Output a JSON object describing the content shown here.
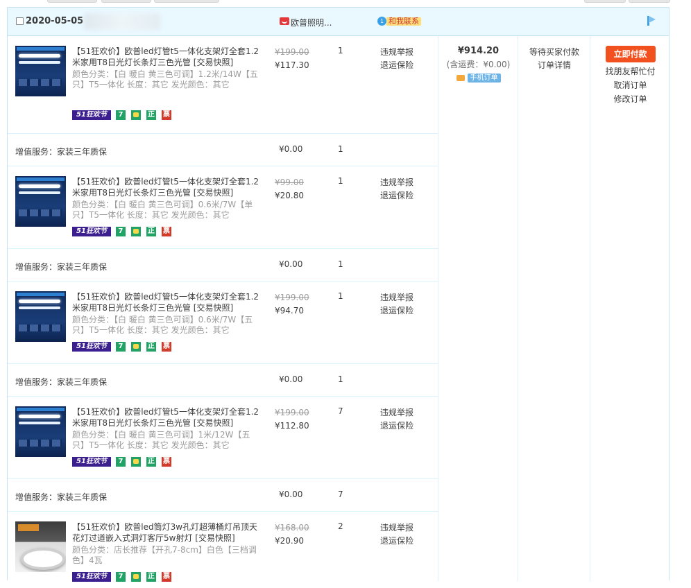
{
  "header": {
    "date": "2020-05-05",
    "shop_name": "欧普照明...",
    "contact_label": "和我联系",
    "chat_badge": "1"
  },
  "items": [
    {
      "title": "【51狂欢价】欧普led灯管t5一体化支架灯全套1.2米家用T8日光灯长条灯三色光管 [交易快照]",
      "spec": "颜色分类：【白 暖白 黄三色可调】1.2米/14W【五只】T5一体化 长度：其它 发光颜色：其它",
      "original_price": "¥199.00",
      "price": "¥117.30",
      "qty": "1",
      "op1": "违规举报",
      "op2": "退运保险"
    },
    {
      "title": "【51狂欢价】欧普led灯管t5一体化支架灯全套1.2米家用T8日光灯长条灯三色光管 [交易快照]",
      "spec": "颜色分类：【白 暖白 黄三色可调】0.6米/7W【单只】T5一体化 长度：其它 发光颜色：其它",
      "original_price": "¥99.00",
      "price": "¥20.80",
      "qty": "1",
      "op1": "违规举报",
      "op2": "退运保险"
    },
    {
      "title": "【51狂欢价】欧普led灯管t5一体化支架灯全套1.2米家用T8日光灯长条灯三色光管 [交易快照]",
      "spec": "颜色分类：【白 暖白 黄三色可调】0.6米/7W【五只】T5一体化 长度：其它 发光颜色：其它",
      "original_price": "¥199.00",
      "price": "¥94.70",
      "qty": "1",
      "op1": "违规举报",
      "op2": "退运保险"
    },
    {
      "title": "【51狂欢价】欧普led灯管t5一体化支架灯全套1.2米家用T8日光灯长条灯三色光管 [交易快照]",
      "spec": "颜色分类：【白 暖白 黄三色可调】1米/12W【五只】T5一体化 长度：其它 发光颜色：其它",
      "original_price": "¥199.00",
      "price": "¥112.80",
      "qty": "7",
      "op1": "违规举报",
      "op2": "退运保险"
    },
    {
      "title": "【51狂欢价】欧普led筒灯3w孔灯超薄桶灯吊顶天花灯过道嵌入式洞灯客厅5w射灯 [交易快照]",
      "spec": "颜色分类：店长推荐【开孔7-8cm】白色【三档调色】4瓦",
      "original_price": "¥168.00",
      "price": "¥20.90",
      "qty": "2",
      "op1": "违规举报",
      "op2": "退运保险"
    }
  ],
  "services": [
    {
      "name": "增值服务：家装三年质保",
      "price": "¥0.00",
      "qty": "1"
    },
    {
      "name": "增值服务：家装三年质保",
      "price": "¥0.00",
      "qty": "1"
    },
    {
      "name": "增值服务：家装三年质保",
      "price": "¥0.00",
      "qty": "1"
    },
    {
      "name": "增值服务：家装三年质保",
      "price": "¥0.00",
      "qty": "7"
    }
  ],
  "badges": {
    "festival": "51狂欢节",
    "seven": "7",
    "zheng": "正",
    "piao": "票"
  },
  "summary": {
    "total": "¥914.20",
    "shipping": "(含运费：¥0.00)",
    "mobile_tag": "手机订单"
  },
  "status": {
    "state": "等待买家付款",
    "detail": "订单详情"
  },
  "actions": {
    "pay": "立即付款",
    "friend_pay": "找朋友帮忙付",
    "cancel": "取消订单",
    "modify": "修改订单"
  }
}
